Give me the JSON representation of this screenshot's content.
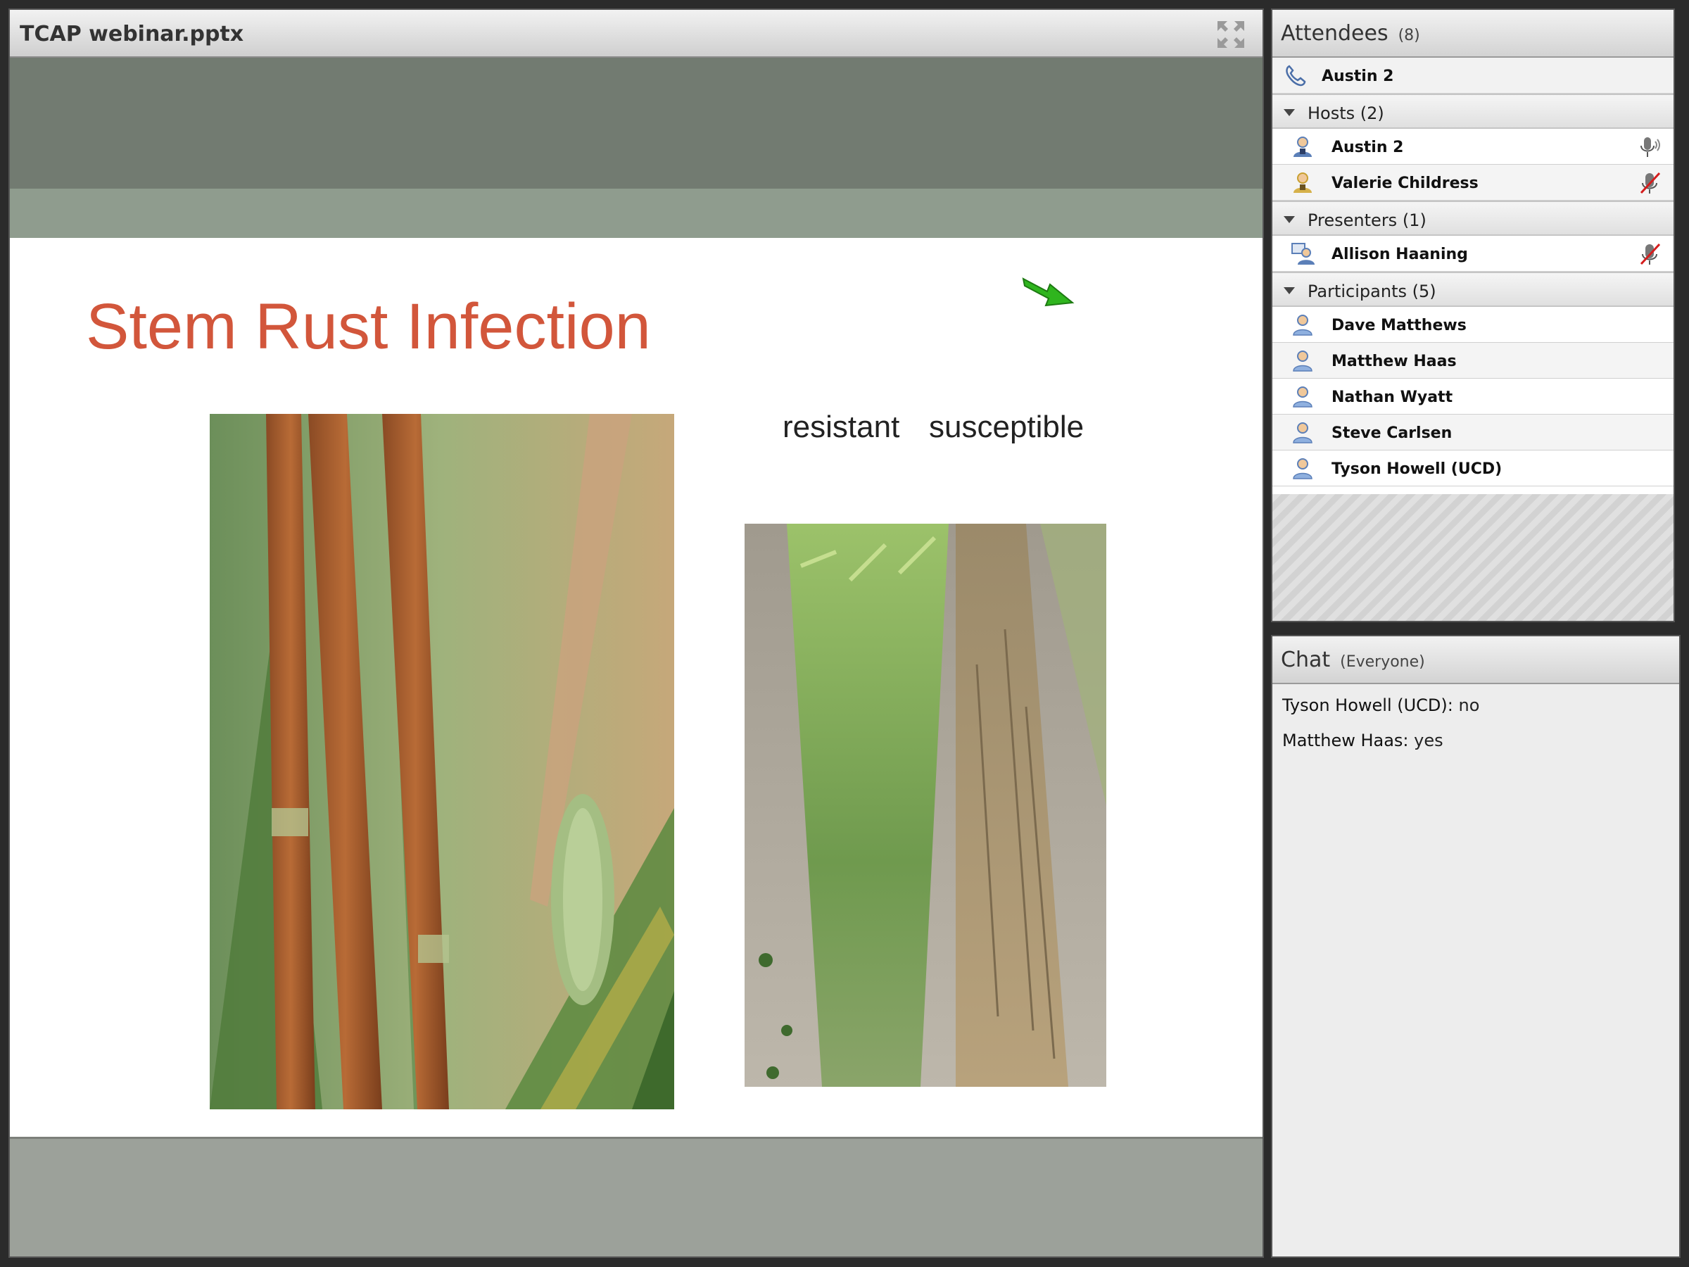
{
  "share": {
    "title": "TCAP webinar.pptx",
    "fullscreen_icon": "fullscreen-icon"
  },
  "slide": {
    "title": "Stem Rust Infection",
    "label_resistant": "resistant",
    "label_susceptible": "susceptible",
    "title_color": "#d2563b",
    "band_dark": "#727b71",
    "band_light": "#8f9c8e"
  },
  "attendees": {
    "title": "Attendees",
    "count": "(8)",
    "phone_user": "Austin 2",
    "groups": {
      "hosts": {
        "label": "Hosts (2)",
        "members": [
          "Austin 2",
          "Valerie Childress"
        ]
      },
      "presenters": {
        "label": "Presenters (1)",
        "members": [
          "Allison Haaning"
        ]
      },
      "participants": {
        "label": "Participants (5)",
        "members": [
          "Dave Matthews",
          "Matthew Haas",
          "Nathan Wyatt",
          "Steve Carlsen",
          "Tyson Howell (UCD)"
        ]
      }
    }
  },
  "chat": {
    "title": "Chat",
    "scope": "(Everyone)",
    "messages": [
      {
        "sender": "Tyson Howell (UCD):",
        "text": "no"
      },
      {
        "sender": "Matthew Haas:",
        "text": "yes"
      }
    ]
  }
}
